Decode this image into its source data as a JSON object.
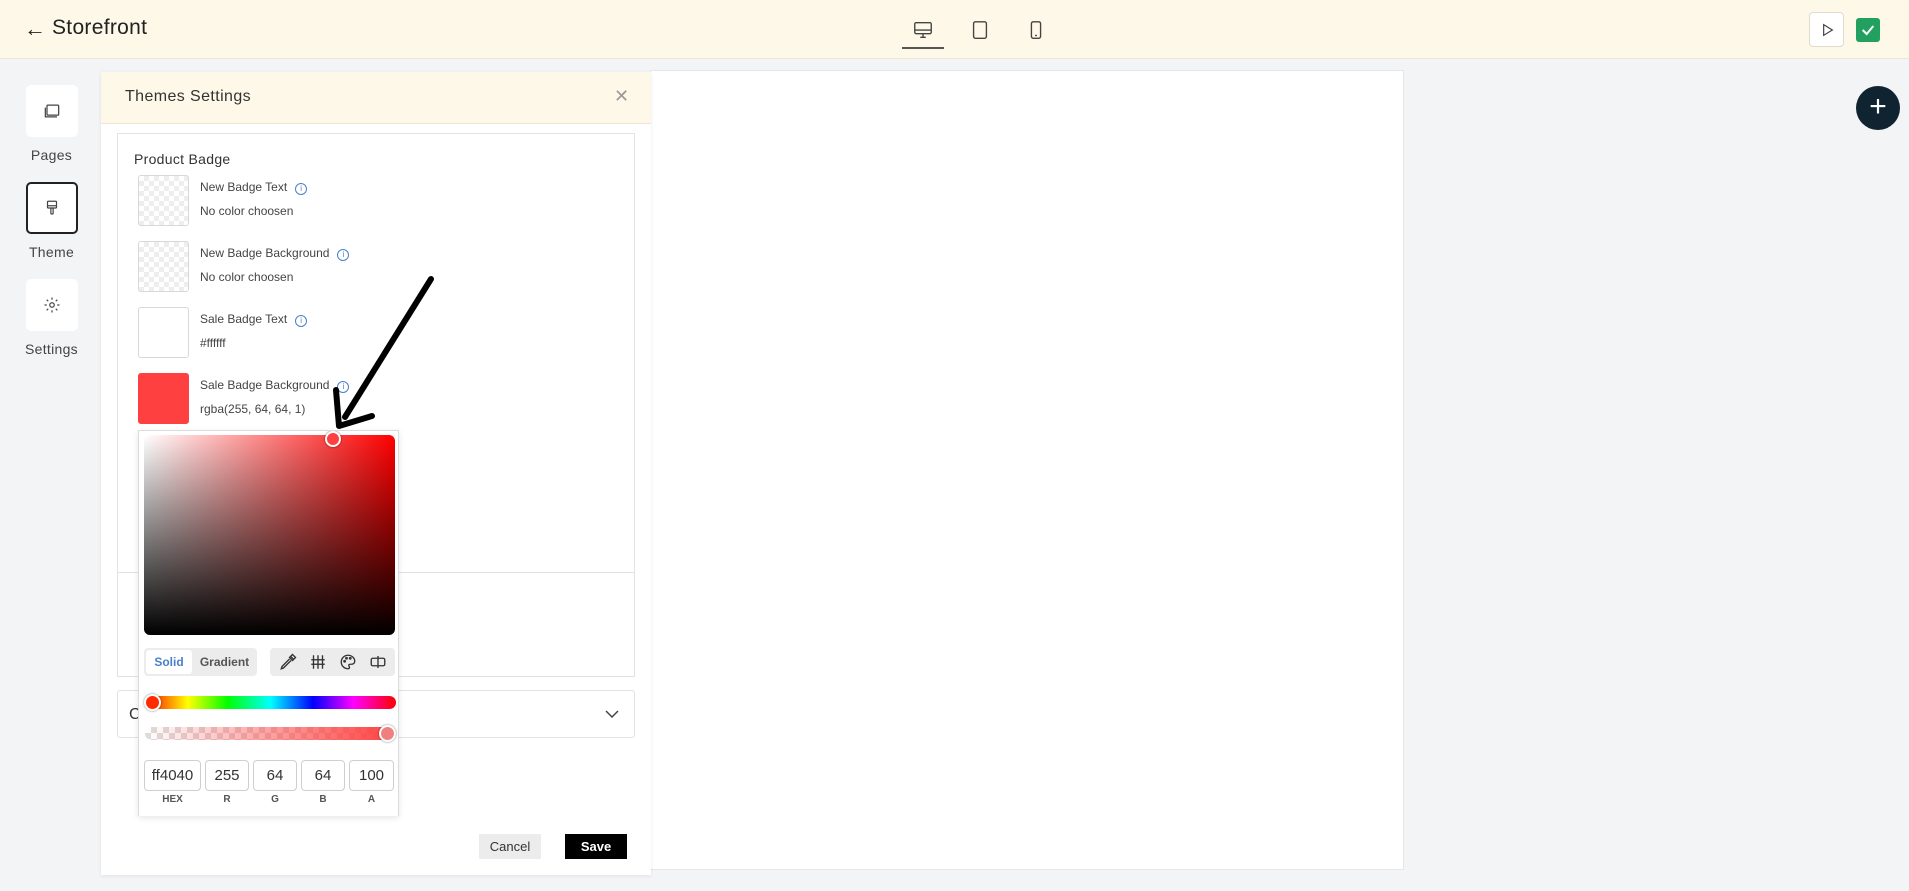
{
  "header": {
    "title": "Storefront",
    "devices": [
      "desktop",
      "tablet",
      "mobile"
    ],
    "active_device": "desktop"
  },
  "rail": {
    "items": [
      {
        "label": "Pages",
        "icon": "pages-icon"
      },
      {
        "label": "Theme",
        "icon": "theme-icon",
        "active": true
      },
      {
        "label": "Settings",
        "icon": "gear-icon"
      }
    ]
  },
  "panel": {
    "title": "Themes Settings",
    "section_title": "Product Badge",
    "colors": [
      {
        "label": "New Badge Text",
        "value": "No color choosen",
        "swatch": ""
      },
      {
        "label": "New Badge Background",
        "value": "No color choosen",
        "swatch": ""
      },
      {
        "label": "Sale Badge Text",
        "value": "#ffffff",
        "swatch": "#ffffff"
      },
      {
        "label": "Sale Badge Background",
        "value": "rgba(255, 64, 64, 1)",
        "swatch": "#ff4040"
      }
    ],
    "accordion_label": "C",
    "cancel_label": "Cancel",
    "save_label": "Save"
  },
  "picker": {
    "modes": [
      "Solid",
      "Gradient"
    ],
    "active_mode": "Solid",
    "hex": "ff4040",
    "r": "255",
    "g": "64",
    "b": "64",
    "a": "100",
    "labels": {
      "hex": "HEX",
      "r": "R",
      "g": "G",
      "b": "B",
      "a": "A"
    },
    "current_color": "#ff4040"
  },
  "colors": {
    "topbar": "#fdf8e8",
    "publish": "#22a060",
    "fab": "#0f2330",
    "accent": "#4a80c8"
  }
}
